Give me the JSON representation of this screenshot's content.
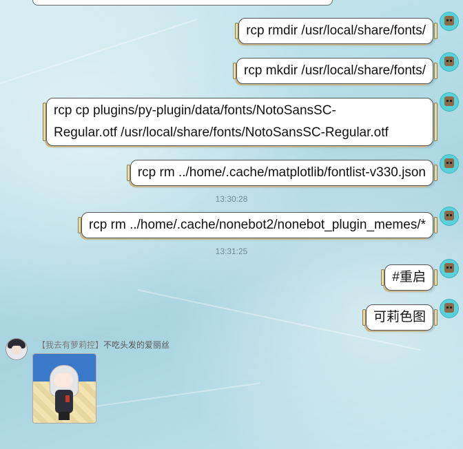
{
  "messages": [
    {
      "text": "rcp rmdir /usr/local/share/fonts/"
    },
    {
      "text": "rcp mkdir /usr/local/share/fonts/"
    },
    {
      "line1": "rcp cp plugins/py-plugin/data/fonts/NotoSansSC-",
      "line2": "Regular.otf /usr/local/share/fonts/NotoSansSC-Regular.otf"
    },
    {
      "text": "rcp rm ../home/.cache/matplotlib/fontlist-v330.json"
    },
    {
      "text": "rcp rm ../home/.cache/nonebot2/nonebot_plugin_memes/*"
    },
    {
      "text": "#重启"
    },
    {
      "text": "可莉色图"
    }
  ],
  "timestamps": [
    "13:30:28",
    "13:31:25"
  ],
  "other_user": {
    "title": "【我去有萝莉控】",
    "name": "不吃头发的爱丽丝"
  },
  "colors": {
    "bubble_bg": "#ffffff",
    "self_avatar": "#5ad0d8",
    "timestamp": "#6f8a93"
  },
  "icons": {
    "self_avatar": "avatar-icon",
    "other_avatar": "avatar-icon"
  }
}
